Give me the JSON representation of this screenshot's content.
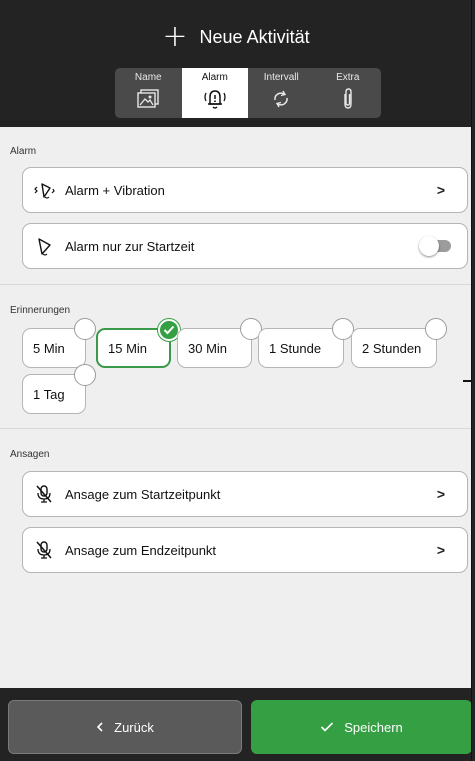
{
  "header": {
    "title": "Neue Aktivität",
    "tabs": [
      {
        "label": "Name",
        "icon": "image-icon",
        "active": false
      },
      {
        "label": "Alarm",
        "icon": "bell-icon",
        "active": true
      },
      {
        "label": "Intervall",
        "icon": "repeat-icon",
        "active": false
      },
      {
        "label": "Extra",
        "icon": "paperclip-icon",
        "active": false
      }
    ]
  },
  "alarm": {
    "section_label": "Alarm",
    "alarm_vibration_label": "Alarm + Vibration",
    "alarm_start_only_label": "Alarm nur zur Startzeit",
    "alarm_start_only_enabled": false
  },
  "reminders": {
    "section_label": "Erinnerungen",
    "options": [
      {
        "label": "5 Min",
        "selected": false
      },
      {
        "label": "15 Min",
        "selected": true
      },
      {
        "label": "30 Min",
        "selected": false
      },
      {
        "label": "1 Stunde",
        "selected": false
      },
      {
        "label": "2 Stunden",
        "selected": false
      },
      {
        "label": "1 Tag",
        "selected": false
      }
    ]
  },
  "announcements": {
    "section_label": "Ansagen",
    "start_label": "Ansage zum Startzeitpunkt",
    "end_label": "Ansage zum Endzeitpunkt"
  },
  "footer": {
    "back_label": "Zurück",
    "save_label": "Speichern"
  },
  "colors": {
    "accent": "#35a043",
    "header_bg": "#232323",
    "content_bg": "#efefef"
  }
}
